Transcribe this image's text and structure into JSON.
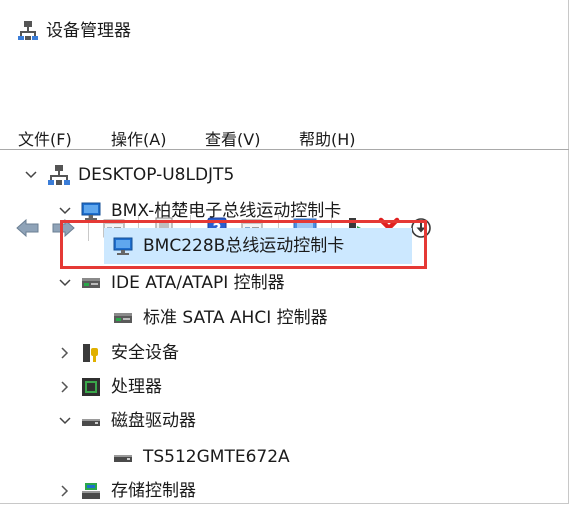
{
  "window": {
    "title": "设备管理器"
  },
  "menu": [
    "文件(F)",
    "操作(A)",
    "查看(V)",
    "帮助(H)"
  ],
  "toolbar": {
    "icons": [
      "back-arrow-icon",
      "forward-arrow-icon",
      "properties-icon",
      "device-page-icon",
      "help-icon",
      "update-driver-icon",
      "monitor-scan-icon",
      "enable-device-icon",
      "uninstall-x-icon",
      "download-circle-icon"
    ]
  },
  "tree": {
    "root": "DESKTOP-U8LDJT5",
    "nodes": [
      {
        "label": "BMX-柏楚电子总线运动控制卡",
        "expanded": true
      },
      {
        "label": "BMC228B总线运动控制卡",
        "selected": true
      },
      {
        "label": "IDE ATA/ATAPI 控制器",
        "expanded": true
      },
      {
        "label": "标准 SATA AHCI 控制器"
      },
      {
        "label": "安全设备",
        "expanded": false
      },
      {
        "label": "处理器",
        "expanded": false
      },
      {
        "label": "磁盘驱动器",
        "expanded": true
      },
      {
        "label": "TS512GMTE672A"
      },
      {
        "label": "存储控制器",
        "expanded": false
      }
    ]
  },
  "colors": {
    "selection": "#cce8ff",
    "highlight_box": "#e53935",
    "device_blue": "#1e6fcf",
    "delete_red": "#e02020"
  }
}
